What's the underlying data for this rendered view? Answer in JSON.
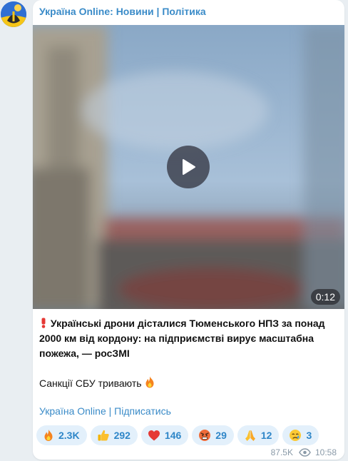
{
  "post": {
    "channel_name": "Україна Online: Новини | Політика",
    "video_duration": "0:12",
    "headline": "Українські дрони дісталися Тюменського НПЗ за понад 2000 км від кордону: на підприємстві вирує масштабна пожежа, — росЗМІ",
    "body": "Санкції СБУ тривають",
    "subscribe_link": "Україна Online | Підписатись",
    "reactions": [
      {
        "emoji": "fire",
        "count": "2.3K"
      },
      {
        "emoji": "thumbs-up",
        "count": "292"
      },
      {
        "emoji": "red-heart",
        "count": "146"
      },
      {
        "emoji": "angry-face",
        "count": "29"
      },
      {
        "emoji": "folded-hands",
        "count": "12"
      },
      {
        "emoji": "crying-face",
        "count": "3"
      }
    ],
    "views": "87.5K",
    "time": "10:58"
  },
  "colors": {
    "link": "#3a8bc8",
    "reaction_bg": "#e3f0fb",
    "reaction_text": "#2e86c8",
    "page_bg": "#e9eef2"
  },
  "icons": [
    "play-icon",
    "exclamation-icon",
    "fire-icon",
    "thumbs-up-icon",
    "heart-icon",
    "angry-face-icon",
    "folded-hands-icon",
    "crying-face-icon",
    "eye-icon"
  ]
}
